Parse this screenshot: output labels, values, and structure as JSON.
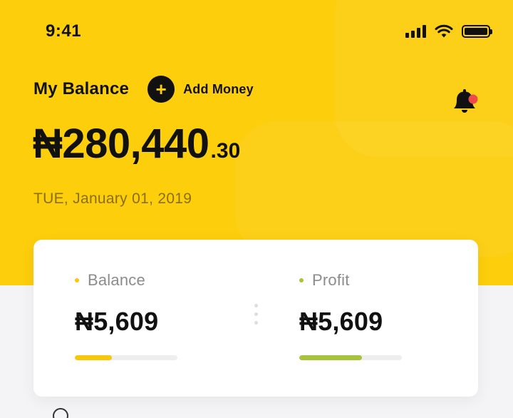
{
  "status_bar": {
    "time": "9:41",
    "icons": [
      "signal-icon",
      "wifi-icon",
      "battery-icon"
    ]
  },
  "header": {
    "title": "My Balance",
    "add_money_icon": "+",
    "add_money_label": "Add Money",
    "notification_icon": "bell-icon",
    "has_notification": true
  },
  "balance": {
    "main": "₦280,440",
    "decimal": ".30"
  },
  "date": "TUE, January 01, 2019",
  "summary": {
    "balance": {
      "label": "Balance",
      "value": "₦5,609",
      "progress": 0.36,
      "color": "#f7c80a"
    },
    "profit": {
      "label": "Profit",
      "value": "₦5,609",
      "progress": 0.61,
      "color": "#a7c23b"
    }
  },
  "colors": {
    "accent": "#fcce0c",
    "notification_dot": "#ef4a4a"
  }
}
